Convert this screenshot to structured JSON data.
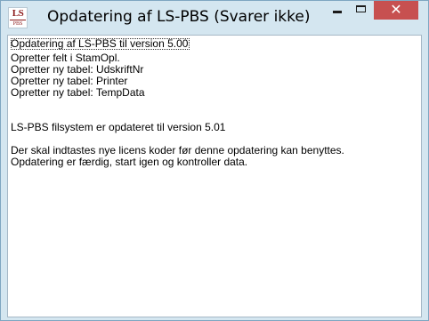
{
  "window": {
    "title": "Opdatering af LS-PBS (Svarer ikke)",
    "icon": {
      "name": "ls-pbs-app-icon",
      "top_text": "LS",
      "bottom_text": "PBS"
    },
    "controls": {
      "minimize_icon": "minimize-icon",
      "maximize_icon": "maximize-icon",
      "close_glyph": "✕",
      "close_color": "#c75050"
    }
  },
  "log": {
    "lines": [
      "Opdatering af LS-PBS til version 5.00",
      "Opretter felt i StamOpl.",
      "Opretter ny tabel: UdskriftNr",
      "Opretter ny tabel: Printer",
      "Opretter ny tabel: TempData",
      "",
      "",
      "LS-PBS filsystem er opdateret til version 5.01",
      "",
      "Der skal indtastes nye licens koder før denne opdatering kan benyttes.",
      "Opdatering er færdig, start igen og kontroller data."
    ]
  }
}
